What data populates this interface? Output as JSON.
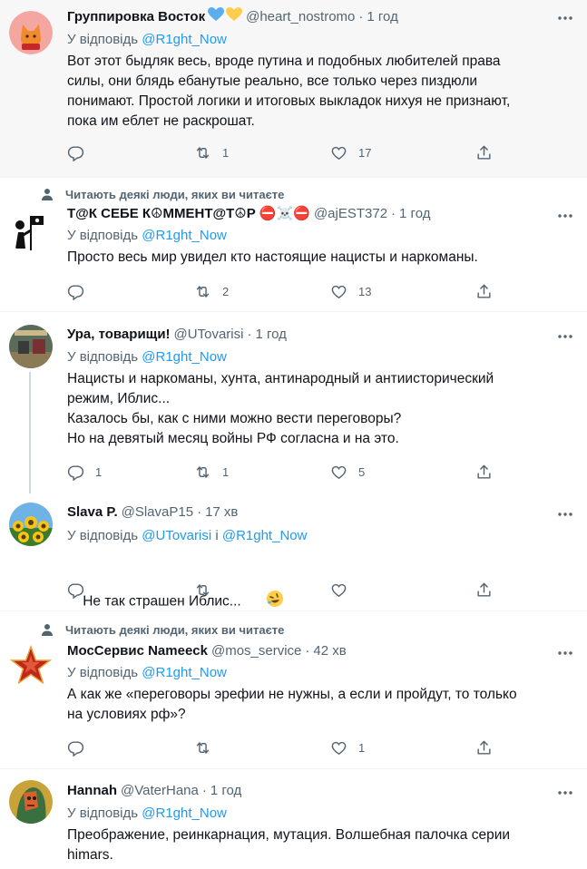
{
  "tweets": [
    {
      "name": "Группировка Восток",
      "name_emojis": [
        "blue-heart",
        "yellow-heart"
      ],
      "handle": "@heart_nostromo",
      "time": "1 год",
      "reply_prefix": "У відповідь ",
      "reply_to": "@R1ght_Now",
      "text": "Вот этот быдляк весь, вроде путина и подобных любителей права\nсилы, они блядь ебанутые реально, все только через пиздюли\nпонимают. Простой логики и итоговых выкладок нихуя не признают,\nпока им еблет не раскрошат.",
      "replies": "",
      "retweets": "1",
      "likes": "17",
      "avatar": "cat-avatar"
    },
    {
      "social_context": "Читають деякі люди, яких ви читаєте",
      "name": "Т@К СЕБЕ К☮ММЕНТ@Т☮Р ⛔☠️⛔",
      "handle": "@ajEST372",
      "time": "1 год",
      "reply_prefix": "У відповідь ",
      "reply_to": "@R1ght_Now",
      "text": "Просто весь мир увидел кто настоящие нацисты и наркоманы.",
      "replies": "",
      "retweets": "2",
      "likes": "13",
      "avatar": "pirate-flag-avatar"
    },
    {
      "name": "Ура, товарищи!",
      "handle": "@UTovarisi",
      "time": "1 год",
      "reply_prefix": "У відповідь ",
      "reply_to": "@R1ght_Now",
      "text": "Нацисты и наркоманы, хунта, антинародный и антиисторический\nрежим, Иблис...\nКазалось бы, как с ними можно вести переговоры?\nНо на девятый месяц войны РФ согласна и на это.",
      "replies": "1",
      "retweets": "1",
      "likes": "5",
      "avatar": "poster-avatar"
    },
    {
      "name": "Slava P.",
      "handle": "@SlavaP15",
      "time": "17 хв",
      "reply_prefix": "У відповідь ",
      "reply_to": "@UTovarisi",
      "reply_joiner": " і ",
      "reply_to_2": "@R1ght_Now",
      "text": "Не так страшен Иблис...",
      "text_emoji": "rolling-laughing",
      "replies": "",
      "retweets": "",
      "likes": "",
      "avatar": "sunflowers-avatar"
    },
    {
      "social_context": "Читають деякі люди, яких ви читаєте",
      "name": "МосСервис Nameeck",
      "handle": "@mos_service",
      "time": "42 хв",
      "reply_prefix": "У відповідь ",
      "reply_to": "@R1ght_Now",
      "text": "А как же «переговоры эрефии не нужны, а если и пройдут, то только\nна условиях рф»?",
      "replies": "",
      "retweets": "",
      "likes": "1",
      "avatar": "red-star-avatar"
    },
    {
      "name": "Hannah",
      "handle": "@VaterHana",
      "time": "1 год",
      "reply_prefix": "У відповідь ",
      "reply_to": "@R1ght_Now",
      "text": "Преображение, реинкарнация, мутация. Волшебная палочка серии\nhimars.",
      "avatar": "abstract-face-avatar"
    }
  ],
  "colors": {
    "accent": "#1d9bf0",
    "secondary_text": "#536471",
    "primary_text": "#0f1419",
    "divider": "#eff3f4",
    "thread_line": "#cfd9de"
  }
}
